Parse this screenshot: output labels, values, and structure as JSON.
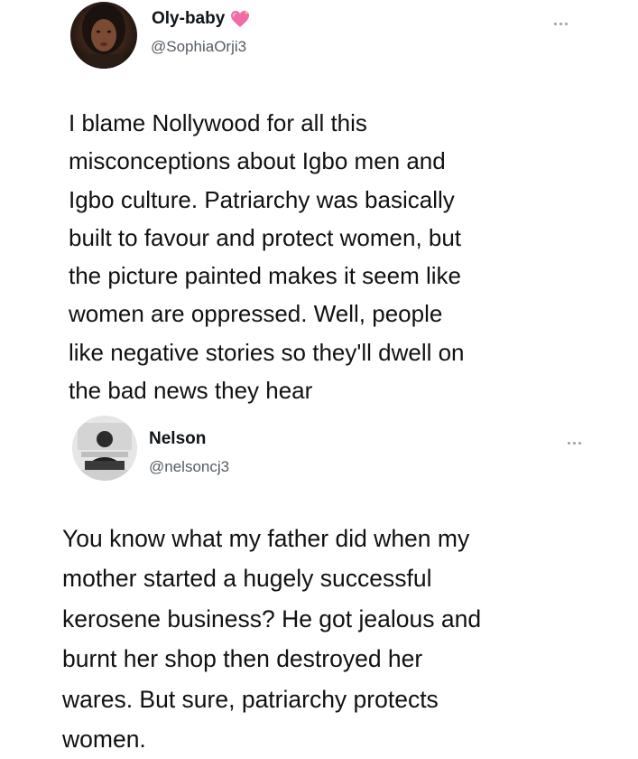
{
  "tweets": [
    {
      "display_name": "Oly-baby",
      "handle": "@SophiaOrji3",
      "badge_icon": "sparkling-heart-icon",
      "more_icon": "more-options-icon",
      "text": "I blame Nollywood for all this\nmisconceptions about Igbo men and\nIgbo culture. Patriarchy was basically\nbuilt to favour and protect women, but\nthe picture painted makes it seem like\nwomen are oppressed. Well, people\nlike negative stories so they'll dwell on\nthe bad news they hear"
    },
    {
      "display_name": "Nelson",
      "handle": "@nelsoncj3",
      "more_icon": "more-options-icon",
      "text": "You know what my father did when my\nmother started a hugely successful\nkerosene business? He got jealous and\nburnt her shop then destroyed her\nwares. But sure, patriarchy protects\nwomen."
    }
  ],
  "colors": {
    "text": "#111111",
    "handle": "#555c63",
    "heart_pink": "#f06ba8",
    "heart_light": "#ffc1dd"
  }
}
